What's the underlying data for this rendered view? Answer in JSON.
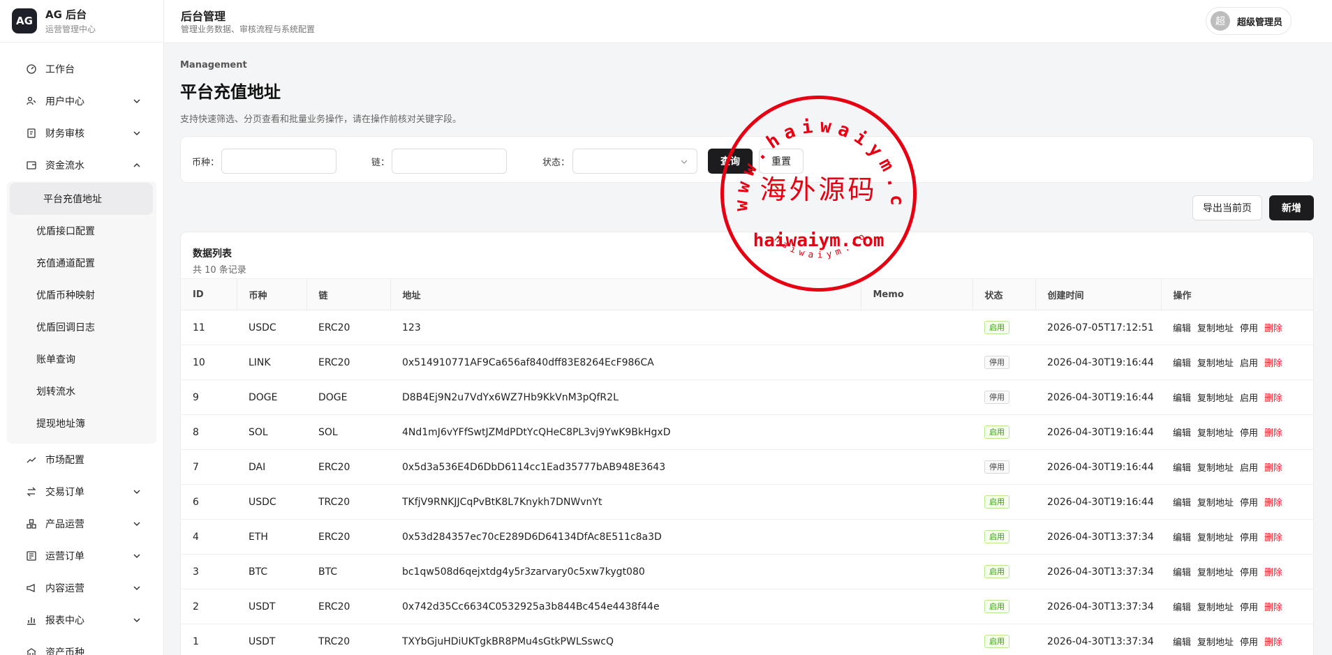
{
  "brand": {
    "logo": "AG",
    "title": "AG 后台",
    "subtitle": "运营管理中心"
  },
  "header": {
    "title": "后台管理",
    "subtitle": "管理业务数据、审核流程与系统配置"
  },
  "user": {
    "avatar": "超",
    "name": "超级管理员"
  },
  "sidebar": {
    "items_top": [
      {
        "label": "工作台",
        "icon": "dashboard-icon",
        "expand": ""
      },
      {
        "label": "用户中心",
        "icon": "users-icon",
        "expand": "down"
      },
      {
        "label": "财务审核",
        "icon": "audit-icon",
        "expand": "down"
      },
      {
        "label": "资金流水",
        "icon": "wallet-icon",
        "expand": "up"
      }
    ],
    "sub_items": [
      "平台充值地址",
      "优盾接口配置",
      "充值通道配置",
      "优盾币种映射",
      "优盾回调日志",
      "账单查询",
      "划转流水",
      "提现地址簿"
    ],
    "items_bottom": [
      {
        "label": "市场配置",
        "icon": "trend-icon",
        "expand": ""
      },
      {
        "label": "交易订单",
        "icon": "exchange-icon",
        "expand": "down"
      },
      {
        "label": "产品运营",
        "icon": "product-icon",
        "expand": "down"
      },
      {
        "label": "运营订单",
        "icon": "order-icon",
        "expand": "down"
      },
      {
        "label": "内容运营",
        "icon": "megaphone-icon",
        "expand": "down"
      },
      {
        "label": "报表中心",
        "icon": "report-icon",
        "expand": "down"
      },
      {
        "label": "资产币种",
        "icon": "asset-icon",
        "expand": ""
      }
    ]
  },
  "page": {
    "eyebrow": "Management",
    "title": "平台充值地址",
    "description": "支持快速筛选、分页查看和批量业务操作，请在操作前核对关键字段。"
  },
  "filters": {
    "currency_label": "币种：",
    "chain_label": "链：",
    "status_label": "状态：",
    "currency_value": "",
    "chain_value": "",
    "status_value": "",
    "query_button": "查询",
    "reset_button": "重置"
  },
  "toolbar": {
    "export_button": "导出当前页",
    "add_button": "新增"
  },
  "table": {
    "title": "数据列表",
    "count": "共 10 条记录",
    "columns": [
      "ID",
      "币种",
      "链",
      "地址",
      "Memo",
      "状态",
      "创建时间",
      "操作"
    ],
    "rows": [
      {
        "id": "11",
        "currency": "USDC",
        "chain": "ERC20",
        "address": "123",
        "memo": "",
        "status": "启用",
        "on": true,
        "created": "2026-07-05T17:12:51",
        "toggle": "停用"
      },
      {
        "id": "10",
        "currency": "LINK",
        "chain": "ERC20",
        "address": "0x514910771AF9Ca656af840dff83E8264EcF986CA",
        "memo": "",
        "status": "停用",
        "on": false,
        "created": "2026-04-30T19:16:44",
        "toggle": "启用"
      },
      {
        "id": "9",
        "currency": "DOGE",
        "chain": "DOGE",
        "address": "D8B4Ej9N2u7VdYx6WZ7Hb9KkVnM3pQfR2L",
        "memo": "",
        "status": "停用",
        "on": false,
        "created": "2026-04-30T19:16:44",
        "toggle": "启用"
      },
      {
        "id": "8",
        "currency": "SOL",
        "chain": "SOL",
        "address": "4Nd1mJ6vYFfSwtJZMdPDtYcQHeC8PL3vj9YwK9BkHgxD",
        "memo": "",
        "status": "启用",
        "on": true,
        "created": "2026-04-30T19:16:44",
        "toggle": "停用"
      },
      {
        "id": "7",
        "currency": "DAI",
        "chain": "ERC20",
        "address": "0x5d3a536E4D6DbD6114cc1Ead35777bAB948E3643",
        "memo": "",
        "status": "停用",
        "on": false,
        "created": "2026-04-30T19:16:44",
        "toggle": "启用"
      },
      {
        "id": "6",
        "currency": "USDC",
        "chain": "TRC20",
        "address": "TKfjV9RNKJJCqPvBtK8L7Knykh7DNWvnYt",
        "memo": "",
        "status": "启用",
        "on": true,
        "created": "2026-04-30T19:16:44",
        "toggle": "停用"
      },
      {
        "id": "4",
        "currency": "ETH",
        "chain": "ERC20",
        "address": "0x53d284357ec70cE289D6D64134DfAc8E511c8a3D",
        "memo": "",
        "status": "启用",
        "on": true,
        "created": "2026-04-30T13:37:34",
        "toggle": "停用"
      },
      {
        "id": "3",
        "currency": "BTC",
        "chain": "BTC",
        "address": "bc1qw508d6qejxtdg4y5r3zarvary0c5xw7kygt080",
        "memo": "",
        "status": "启用",
        "on": true,
        "created": "2026-04-30T13:37:34",
        "toggle": "停用"
      },
      {
        "id": "2",
        "currency": "USDT",
        "chain": "ERC20",
        "address": "0x742d35Cc6634C0532925a3b844Bc454e4438f44e",
        "memo": "",
        "status": "启用",
        "on": true,
        "created": "2026-04-30T13:37:34",
        "toggle": "停用"
      },
      {
        "id": "1",
        "currency": "USDT",
        "chain": "TRC20",
        "address": "TXYbGjuHDiUKTgkBR8PMu4sGtkPWLSswcQ",
        "memo": "",
        "status": "启用",
        "on": true,
        "created": "2026-04-30T13:37:34",
        "toggle": "停用"
      }
    ],
    "ops": {
      "edit": "编辑",
      "copy": "复制地址",
      "delete": "删除"
    }
  },
  "watermark": {
    "top_arc": "www.haiwaiym.com",
    "center": "海外源码",
    "domain": "haiwaiym.com",
    "bottom_arc": "haiwaiym.com",
    "color": "#e60012"
  },
  "colors": {
    "accent_dark": "#1c1c1e",
    "danger": "#f5222d",
    "success": "#389e0d"
  }
}
